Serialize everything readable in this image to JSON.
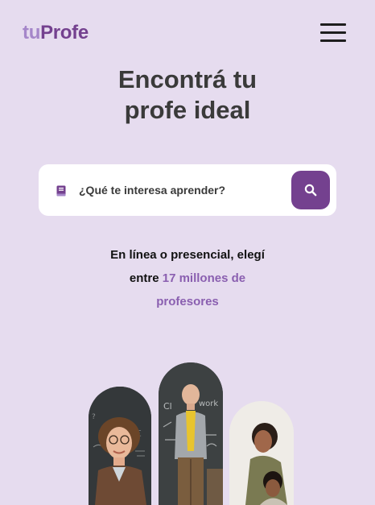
{
  "header": {
    "logo_prefix": "tu",
    "logo_suffix": "Profe",
    "menu_icon": "hamburger-menu-icon"
  },
  "hero": {
    "title_line1": "Encontrá tu",
    "title_line2": "profe ideal"
  },
  "search": {
    "placeholder": "¿Qué te interesa aprender?",
    "leading_icon": "book-icon",
    "button_icon": "search-icon"
  },
  "tagline": {
    "line1": "En línea o presencial, elegí",
    "line2_prefix": "entre ",
    "line2_accent": "17 millones de",
    "line3_accent": "profesores"
  },
  "colors": {
    "background": "#e6dcef",
    "brand_dark": "#74418f",
    "brand_light": "#a586c9",
    "accent_text": "#8a5fb0"
  }
}
